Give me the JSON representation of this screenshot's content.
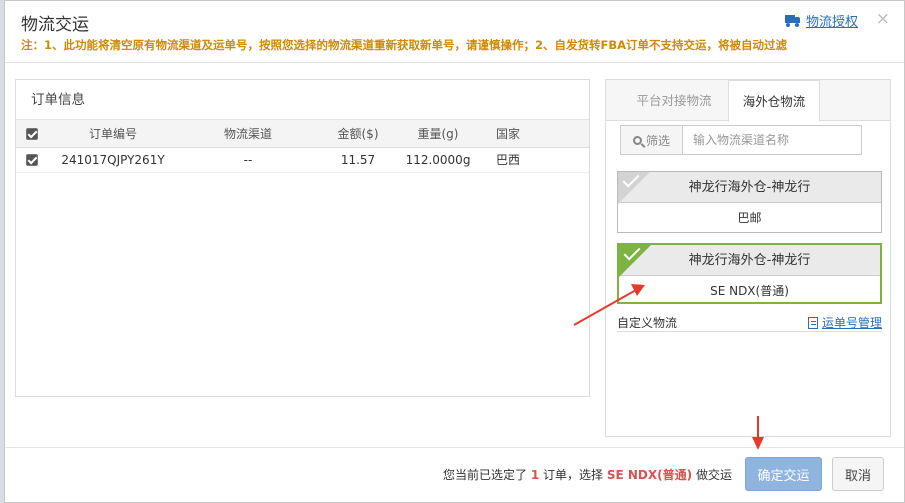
{
  "dialog": {
    "title": "物流交运",
    "notice": "注：1、此功能将清空原有物流渠道及运单号，按照您选择的物流渠道重新获取新单号，请谨慎操作；2、自发货转FBA订单不支持交运，将被自动过滤",
    "auth_link": "物流授权",
    "close": "×"
  },
  "order_panel": {
    "title": "订单信息",
    "columns": [
      "订单编号",
      "物流渠道",
      "金额($)",
      "重量(g)",
      "国家"
    ],
    "rows": [
      {
        "order_no": "241017QJPY261Y",
        "channel": "--",
        "amount": "11.57",
        "weight": "112.0000g",
        "country": "巴西"
      }
    ]
  },
  "logistics_panel": {
    "tabs": [
      "平台对接物流",
      "海外仓物流"
    ],
    "active_tab": "海外仓物流",
    "search_prefix": "筛选",
    "search_placeholder": "输入物流渠道名称",
    "cards": [
      {
        "provider": "神龙行海外仓-神龙行",
        "service": "巴邮",
        "selected": false
      },
      {
        "provider": "神龙行海外仓-神龙行",
        "service": "SE NDX(普通)",
        "selected": true
      }
    ],
    "custom_label": "自定义物流",
    "tracking_link": "运单号管理"
  },
  "footer": {
    "summary_prefix": "您当前已选定了",
    "summary_count": "1",
    "summary_mid": "订单，选择",
    "summary_channel": "SE NDX(普通)",
    "summary_suffix": "做交运",
    "confirm": "确定交运",
    "cancel": "取消"
  },
  "colors": {
    "notice": "#d08a08",
    "link": "#2a6ebb",
    "selected_border": "#7cb342",
    "emphasis": "#d9534f",
    "confirm_button": "#8fb4e0",
    "annotation_arrow": "#e8392b"
  }
}
